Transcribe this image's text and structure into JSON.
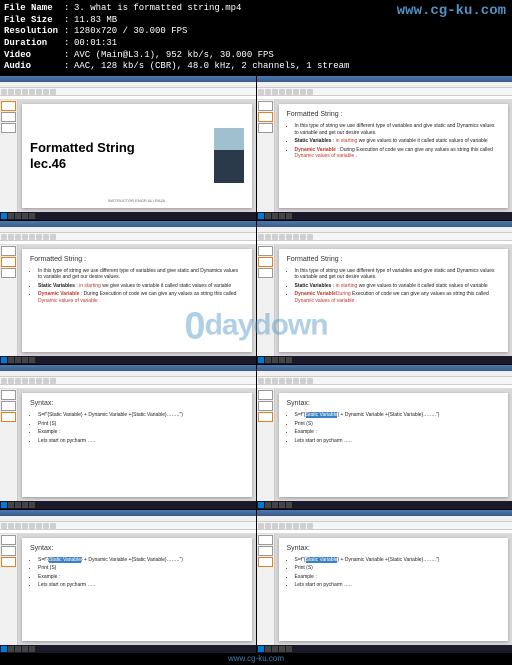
{
  "metadata": {
    "filename_label": "File Name",
    "filename": "3. what is formatted string.mp4",
    "filesize_label": "File Size",
    "filesize": "11.83 MB",
    "resolution_label": "Resolution",
    "resolution": "1280x720 / 30.000 FPS",
    "duration_label": "Duration",
    "duration": "00:01:31",
    "video_label": "Video",
    "video": "AVC (Main@L3.1), 952 kb/s, 30.000 FPS",
    "audio_label": "Audio",
    "audio": "AAC, 128 kb/s (CBR), 48.0 kHz, 2 channels, 1 stream"
  },
  "watermarks": {
    "top": "www.cg-ku.com",
    "center": "0daydown",
    "footer": "www.cg-ku.com"
  },
  "slides": {
    "title": {
      "line1": "Formatted String",
      "line2": "lec.46",
      "instructor": "INSTRUCTOR ENGR.ALI RAZA"
    },
    "content": {
      "heading": "Formatted  String :",
      "bullet1": "In this type of string we use different type of variables and give static and Dynamics values to variable and get our desire values.",
      "static_label": "Static Variables",
      "static_text1": " : ",
      "static_text_red": "in starting",
      "static_text2": " we give values to variable it called static values of variable",
      "dynamic_label": "Dynamic Variable",
      "dynamic_text1": " : During Execution of code  we can give any values as string this called ",
      "dynamic_text_red": "Dynamic values of variable ."
    },
    "syntax": {
      "heading": "Syntax:",
      "line1_a": "S=f\"{",
      "line1_hl": "Static Variable",
      "line1_b": "} + Dynamic Variable  +{Static Variable}……..\")",
      "line2": "Print (S)",
      "line3": "Example :",
      "line4": "Lets start on pycharm ….."
    }
  }
}
